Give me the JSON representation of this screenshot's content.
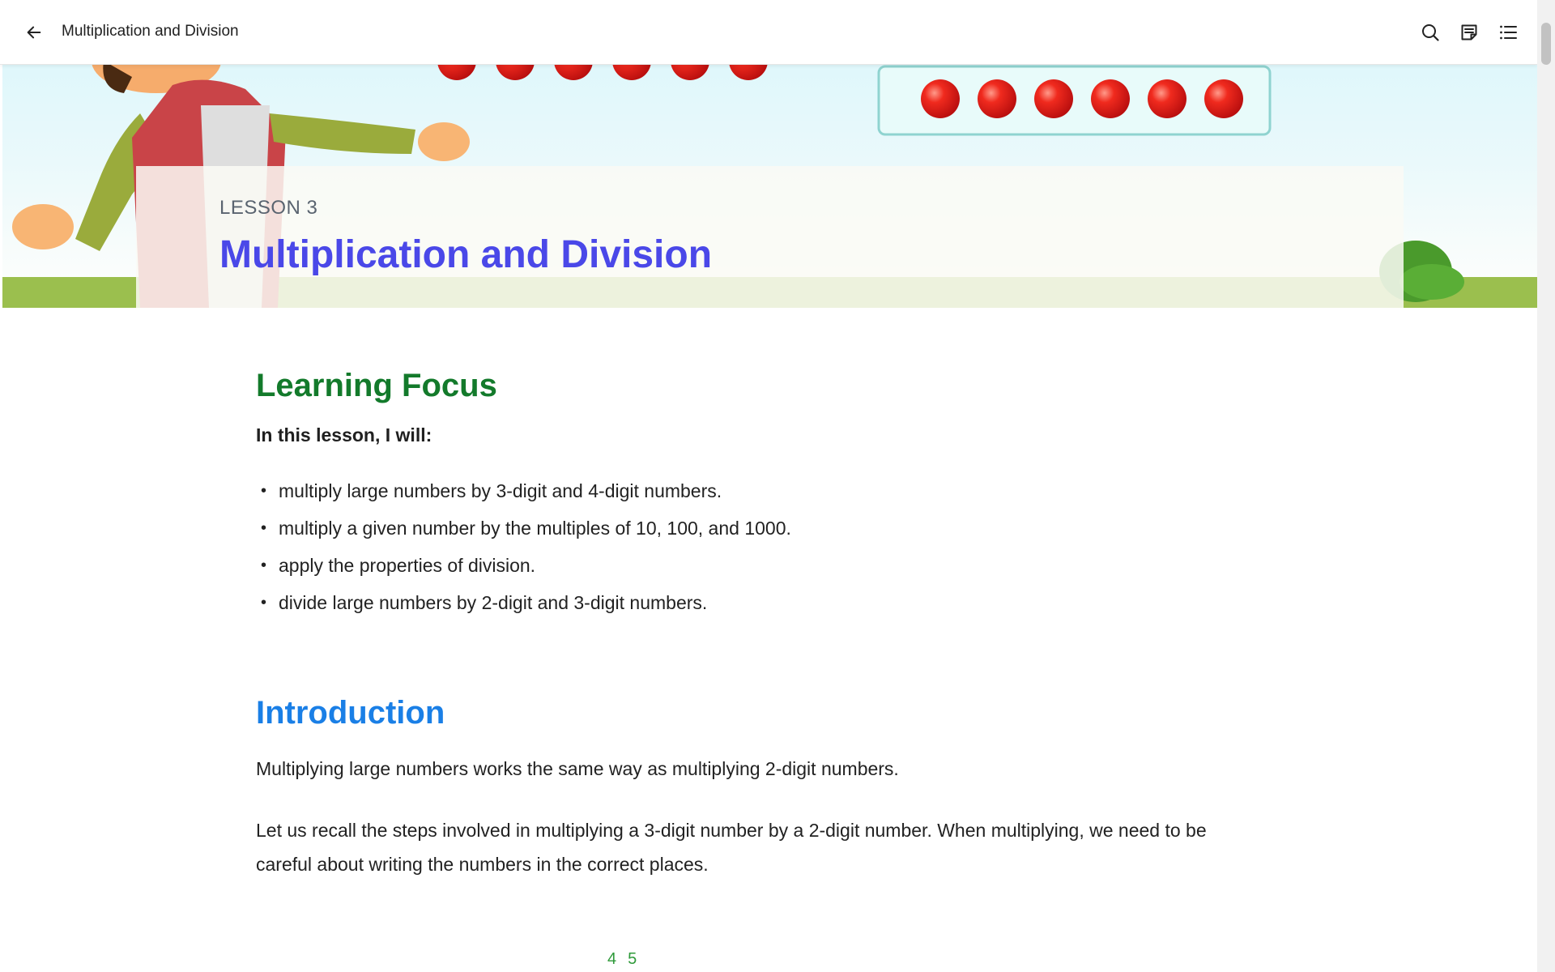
{
  "topbar": {
    "title": "Multiplication and Division",
    "back_icon": "arrow-left-icon",
    "actions": [
      {
        "name": "search",
        "icon": "search-icon"
      },
      {
        "name": "notes",
        "icon": "notes-icon"
      },
      {
        "name": "contents",
        "icon": "list-icon"
      }
    ]
  },
  "banner": {
    "lesson_label": "LESSON 3",
    "lesson_title": "Multiplication and Division"
  },
  "learning_focus": {
    "heading": "Learning Focus",
    "subheading": "In this lesson, I will:",
    "items": [
      "multiply large numbers by 3-digit and 4-digit numbers.",
      "multiply a given number by the multiples of 10, 100, and 1000.",
      "apply the properties of division.",
      "divide large numbers by 2-digit and 3-digit numbers."
    ]
  },
  "introduction": {
    "heading": "Introduction",
    "paragraph1": "Multiplying large numbers works the same way as multiplying 2-digit numbers.",
    "paragraph2": "Let us recall the steps involved in multiplying a 3-digit number by a 2-digit number. When multiplying, we need to be careful about writing the numbers in the correct places."
  },
  "page_numbers": [
    "4",
    "5"
  ],
  "colors": {
    "lesson_title": "#4a48e8",
    "learning_focus": "#137a2b",
    "introduction": "#1a7fe6",
    "page_numbers": "#2f9a3a",
    "counter_red": "#e61e1e"
  }
}
